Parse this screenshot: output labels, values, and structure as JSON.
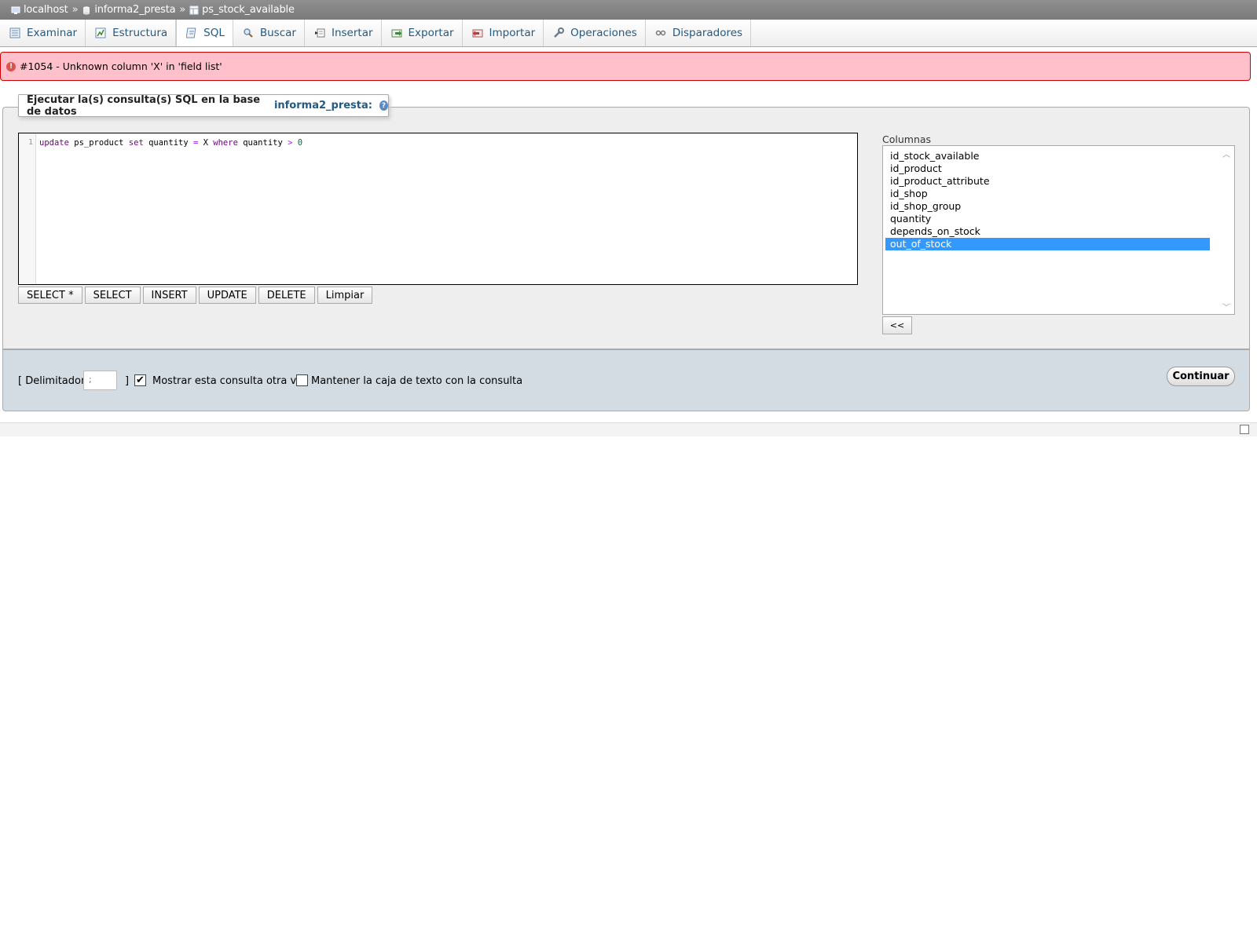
{
  "breadcrumb": {
    "server": "localhost",
    "database": "informa2_presta",
    "table": "ps_stock_available",
    "separator": "»"
  },
  "tabs": [
    {
      "label": "Examinar",
      "icon": "browse-icon"
    },
    {
      "label": "Estructura",
      "icon": "structure-icon"
    },
    {
      "label": "SQL",
      "icon": "sql-icon",
      "active": true
    },
    {
      "label": "Buscar",
      "icon": "search-icon"
    },
    {
      "label": "Insertar",
      "icon": "insert-icon"
    },
    {
      "label": "Exportar",
      "icon": "export-icon"
    },
    {
      "label": "Importar",
      "icon": "import-icon"
    },
    {
      "label": "Operaciones",
      "icon": "wrench-icon"
    },
    {
      "label": "Disparadores",
      "icon": "triggers-icon"
    }
  ],
  "error": {
    "message": "#1054 - Unknown column 'X' in 'field list'"
  },
  "query_box": {
    "legend_prefix": "Ejecutar la(s) consulta(s) SQL en la base de datos",
    "legend_db": "informa2_presta:",
    "line_number": "1",
    "code": "update ps_product set quantity = X where quantity > 0"
  },
  "buttons": [
    "SELECT *",
    "SELECT",
    "INSERT",
    "UPDATE",
    "DELETE",
    "Limpiar"
  ],
  "columns": {
    "label": "Columnas",
    "items": [
      "id_stock_available",
      "id_product",
      "id_product_attribute",
      "id_shop",
      "id_shop_group",
      "quantity",
      "depends_on_stock",
      "out_of_stock"
    ],
    "selected": "out_of_stock",
    "insert_button": "<<"
  },
  "footer": {
    "delimiter_label": "[ Delimitador",
    "delimiter_value": ";",
    "delimiter_close": "]",
    "show_again_label": "Mostrar esta consulta otra vez",
    "show_again_checked": true,
    "keep_box_label": "Mantener la caja de texto con la consulta",
    "keep_box_checked": false,
    "submit_label": "Continuar"
  },
  "colors": {
    "error_bg": "#ffc0cb",
    "link": "#235a81",
    "selection": "#3399ff"
  }
}
